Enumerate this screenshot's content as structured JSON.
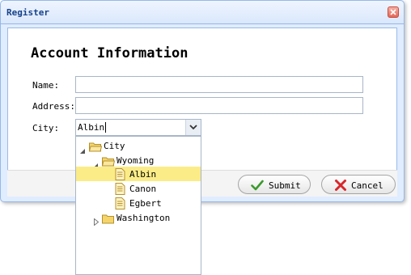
{
  "dialog": {
    "title": "Register",
    "heading": "Account Information"
  },
  "form": {
    "name_label": "Name:",
    "name_value": "",
    "address_label": "Address:",
    "address_value": "",
    "city_label": "City:",
    "city_value": "Albin"
  },
  "buttons": {
    "submit_label": "Submit",
    "cancel_label": "Cancel"
  },
  "tree": {
    "root": "City",
    "state1": "Wyoming",
    "city1": "Albin",
    "city2": "Canon",
    "city3": "Egbert",
    "state2": "Washington",
    "selected": "Albin"
  },
  "colors": {
    "accent_border": "#95b8e7",
    "title_text": "#15428b",
    "selection": "#fbec88",
    "folder": "#f5d46b"
  },
  "icons": {
    "close": "close-icon",
    "dropdown": "chevron-down-icon",
    "submit": "checkmark-icon",
    "cancel": "x-icon",
    "folder": "folder-icon",
    "file": "file-icon"
  }
}
